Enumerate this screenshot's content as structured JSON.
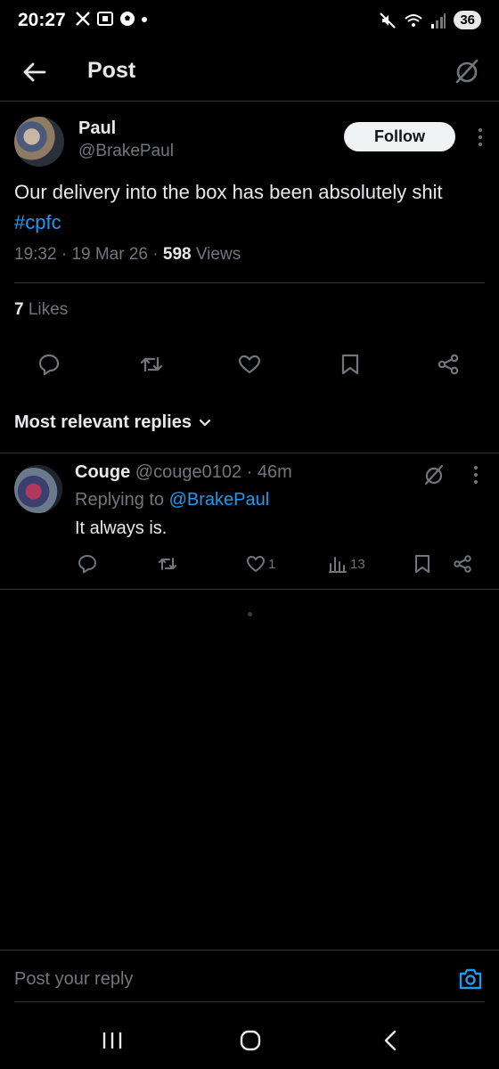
{
  "status_bar": {
    "time": "20:27",
    "battery": "36",
    "left_icons": [
      "x-logo-icon",
      "screenshot-icon",
      "football-icon",
      "dot-icon"
    ],
    "right_icons": [
      "mute-icon",
      "wifi-icon",
      "signal-icon"
    ]
  },
  "header": {
    "title": "Post",
    "back_icon": "back-arrow-icon",
    "grok_icon": "grok-icon"
  },
  "post": {
    "author_name": "Paul",
    "author_handle": "@BrakePaul",
    "follow_label": "Follow",
    "text": "Our delivery into the box has been absolutely shit ",
    "hashtag": "#cpfc",
    "time": "19:32",
    "date": "19 Mar 26",
    "views_count": "598",
    "views_label": " Views",
    "likes_count": "7",
    "likes_label": " Likes",
    "actions": [
      "reply-icon",
      "repost-icon",
      "like-icon",
      "bookmark-icon",
      "share-icon"
    ]
  },
  "replies_sort": {
    "label": "Most relevant replies"
  },
  "reply": {
    "name": "Couge",
    "handle": "@couge0102",
    "time": "46m",
    "replying_prefix": "Replying to ",
    "replying_mention": "@BrakePaul",
    "text": "It always is.",
    "like_count": "1",
    "views_count": "13"
  },
  "composer": {
    "placeholder": "Post your reply"
  },
  "colors": {
    "background": "#000000",
    "text_primary": "#e7e9ea",
    "text_secondary": "#71767b",
    "accent": "#1d9bf0",
    "divider": "#2f3336"
  }
}
